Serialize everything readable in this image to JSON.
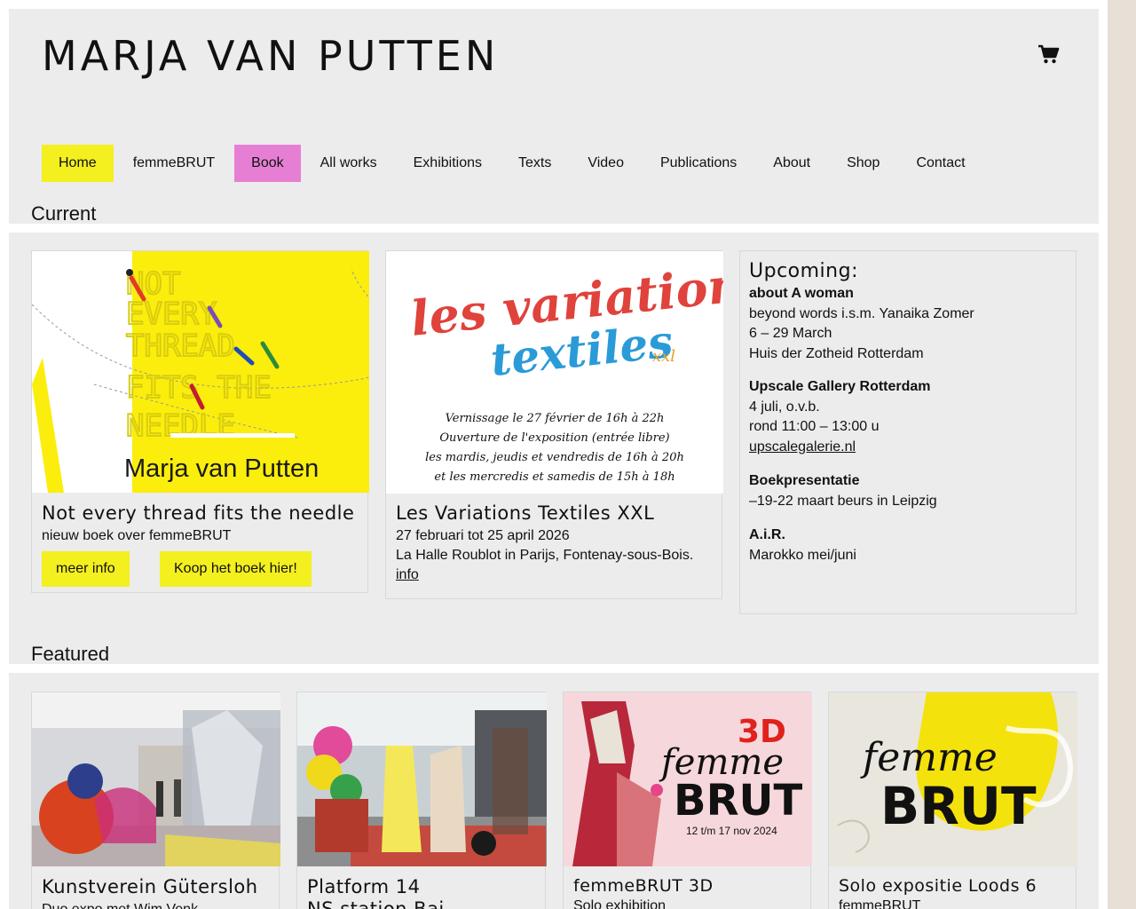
{
  "site": {
    "title": "MARJA VAN PUTTEN"
  },
  "nav": [
    {
      "label": "Home",
      "style": "yellow"
    },
    {
      "label": "femmeBRUT",
      "style": ""
    },
    {
      "label": "Book",
      "style": "pink"
    },
    {
      "label": "All works",
      "style": ""
    },
    {
      "label": "Exhibitions",
      "style": ""
    },
    {
      "label": "Texts",
      "style": ""
    },
    {
      "label": "Video",
      "style": ""
    },
    {
      "label": "Publications",
      "style": ""
    },
    {
      "label": "About",
      "style": ""
    },
    {
      "label": "Shop",
      "style": ""
    },
    {
      "label": "Contact",
      "style": ""
    }
  ],
  "current": {
    "heading": "Current",
    "book": {
      "cover_lines": [
        "NOT",
        "EVERY",
        "THREAD",
        "FITS THE",
        "NEEDLE"
      ],
      "cover_author": "Marja van Putten",
      "title": "Not every thread fits the needle",
      "subtitle": "nieuw boek over femmeBRUT",
      "btn_info": "meer info",
      "btn_buy": "Koop het boek hier!"
    },
    "expo": {
      "poster_title_1": "les variations",
      "poster_title_2": "textiles",
      "poster_xxl": "xxl",
      "poster_lines": [
        "Vernissage le 27 février de 16h à 22h",
        "Ouverture de l'exposition (entrée libre)",
        "les mardis, jeudis et vendredis de 16h à 20h",
        "et les mercredis et samedis de 15h à 18h"
      ],
      "title": "Les Variations Textiles XXL",
      "dates": "27 februari tot 25 april 2026",
      "venue": "La Halle Roublot in Parijs, Fontenay-sous-Bois.",
      "link": "info"
    },
    "upcoming": {
      "heading": "Upcoming:",
      "items": [
        {
          "bold": "about A woman",
          "lines": [
            "beyond words i.s.m. Yanaika Zomer",
            "6 – 29 March",
            "Huis der Zotheid Rotterdam"
          ],
          "link": ""
        },
        {
          "bold": "Upscale Gallery Rotterdam",
          "lines": [
            "4 juli, o.v.b.",
            "rond 11:00 – 13:00 u"
          ],
          "link": "upscalegalerie.nl"
        },
        {
          "bold": "Boekpresentatie",
          "lines": [
            "–19-22 maart beurs in Leipzig"
          ],
          "link": ""
        },
        {
          "bold": "A.i.R.",
          "lines": [
            "Marokko mei/juni"
          ],
          "link": ""
        }
      ]
    }
  },
  "featured": {
    "heading": "Featured",
    "items": [
      {
        "title": "Kunstverein Gütersloh",
        "subtitle": "Duo expo met Wim Venk"
      },
      {
        "title": "Platform 14",
        "subtitle": "NS station Bai"
      },
      {
        "title": "femmeBRUT 3D",
        "subtitle": "Solo exhibition",
        "poster_3d": "3D",
        "poster_femme": "femme",
        "poster_brut": "BRUT",
        "poster_dates": "12 t/m 17 nov 2024"
      },
      {
        "title": "Solo expositie Loods 6",
        "subtitle": "femmeBRUT",
        "poster_femme": "femme",
        "poster_brut": "BRUT"
      }
    ]
  },
  "colors": {
    "accent_yellow": "#f4ef1f",
    "accent_pink": "#e67fd3",
    "panel": "#ececec",
    "side": "#e8e0d6"
  },
  "icons": {
    "cart": "shopping-cart-icon"
  }
}
